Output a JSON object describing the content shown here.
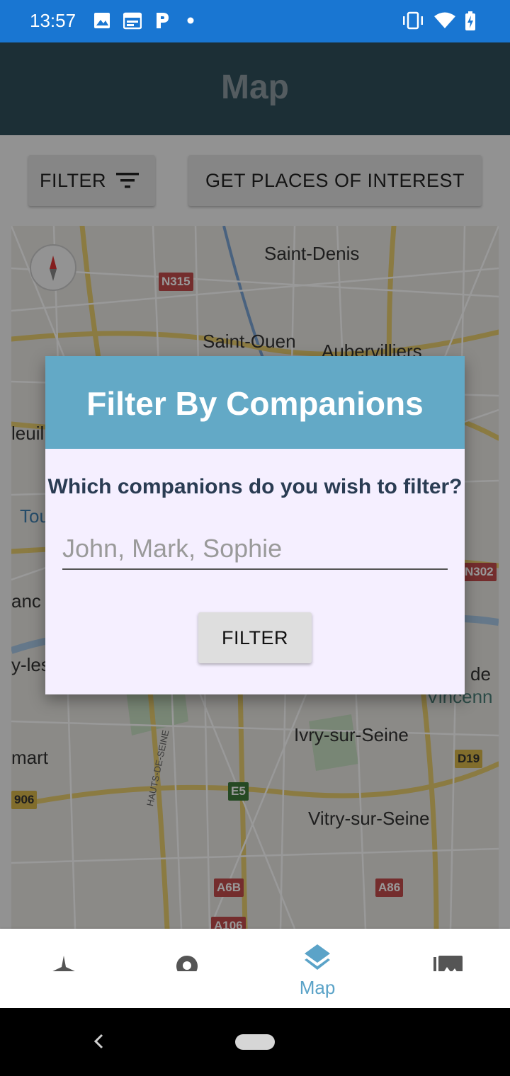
{
  "status_bar": {
    "time": "13:57"
  },
  "app_bar": {
    "title": "Map"
  },
  "toolbar": {
    "filter_label": "FILTER",
    "places_label": "GET PLACES OF INTEREST"
  },
  "map": {
    "labels": [
      "Saint-Denis",
      "Saint-Ouen",
      "Aubervilliers",
      "Ivry-sur-Seine",
      "Vitry-sur-Seine",
      "HAUTS-DE-SEINE"
    ],
    "badges": [
      "N315",
      "N302",
      "D19",
      "E5",
      "A6B",
      "A86",
      "906",
      "A106"
    ],
    "edge_fragments": [
      "leuil",
      "Tou",
      "anc",
      "y-les",
      "mart",
      "is de",
      "Vincenn"
    ]
  },
  "dialog": {
    "title": "Filter By Companions",
    "question": "Which companions do you wish to filter?",
    "input_value": "",
    "input_placeholder": "John, Mark, Sophie",
    "button_label": "FILTER"
  },
  "bottom_nav": {
    "items": [
      {
        "icon": "airplane-icon",
        "label": ""
      },
      {
        "icon": "location-pin-icon",
        "label": ""
      },
      {
        "icon": "layers-icon",
        "label": "Map"
      },
      {
        "icon": "photos-icon",
        "label": ""
      }
    ],
    "active_index": 2
  },
  "colors": {
    "status_bar": "#1976d2",
    "app_bar": "#2f4f5b",
    "dialog_header": "#63a9c6",
    "accent": "#5ba3c8"
  }
}
